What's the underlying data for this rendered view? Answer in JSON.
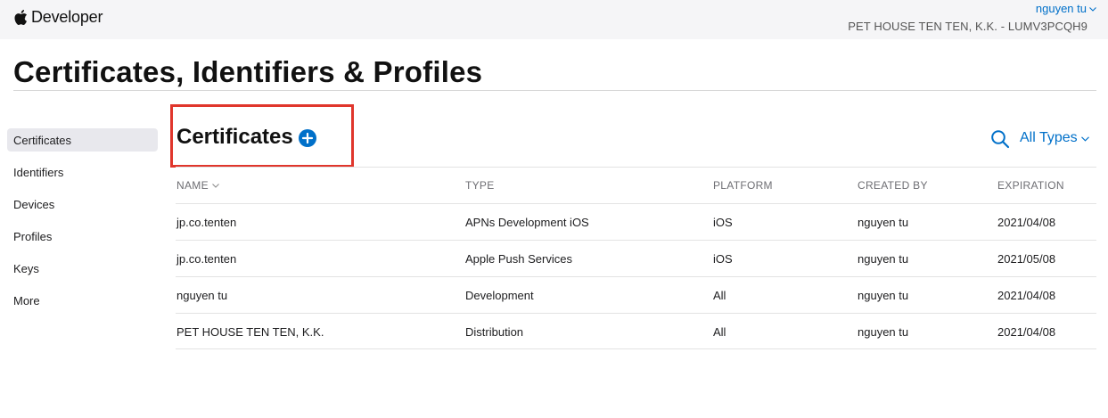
{
  "header": {
    "brand": "Developer",
    "user": "nguyen tu",
    "team": "PET HOUSE TEN TEN, K.K. - LUMV3PCQH9"
  },
  "page_title": "Certificates, Identifiers & Profiles",
  "sidebar": {
    "items": [
      {
        "label": "Certificates",
        "active": true
      },
      {
        "label": "Identifiers"
      },
      {
        "label": "Devices"
      },
      {
        "label": "Profiles"
      },
      {
        "label": "Keys"
      },
      {
        "label": "More"
      }
    ]
  },
  "section": {
    "title": "Certificates",
    "filter": "All Types",
    "highlight_color": "#e0362c",
    "accent_color": "#0070c9"
  },
  "table": {
    "columns": [
      "NAME",
      "TYPE",
      "PLATFORM",
      "CREATED BY",
      "EXPIRATION"
    ],
    "rows": [
      [
        "jp.co.tenten",
        "APNs Development iOS",
        "iOS",
        "nguyen tu",
        "2021/04/08"
      ],
      [
        "jp.co.tenten",
        "Apple Push Services",
        "iOS",
        "nguyen tu",
        "2021/05/08"
      ],
      [
        "nguyen tu",
        "Development",
        "All",
        "nguyen tu",
        "2021/04/08"
      ],
      [
        "PET HOUSE TEN TEN, K.K.",
        "Distribution",
        "All",
        "nguyen tu",
        "2021/04/08"
      ]
    ]
  }
}
